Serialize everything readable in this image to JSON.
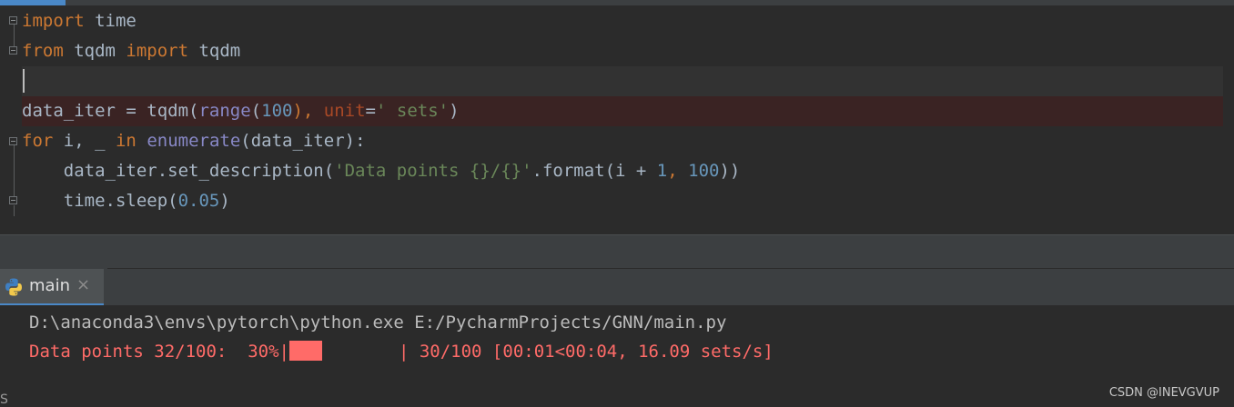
{
  "editor": {
    "lines": [
      {
        "kw1": "import",
        "t1": " time"
      },
      {
        "kw1": "from",
        "t1": " tqdm ",
        "kw2": "import",
        "t2": " tqdm"
      },
      {
        "text": ""
      },
      {
        "a": "data_iter = tqdm(",
        "b": "range",
        "c": "(",
        "d": "100",
        "e": "), ",
        "f": "unit",
        "g": "=",
        "h": "' sets'",
        "i": ")"
      },
      {
        "a": "for",
        "b": " i, _ ",
        "c": "in",
        "d": " ",
        "e": "enumerate",
        "f": "(data_iter):"
      },
      {
        "a": "    data_iter.set_description(",
        "b": "'Data points {}/{}'",
        "c": ".format(i + ",
        "d": "1",
        "e": ", ",
        "f": "100",
        "g": "))"
      },
      {
        "a": "    time.sleep(",
        "b": "0.05",
        "c": ")"
      }
    ]
  },
  "run_tab": {
    "label": "main",
    "close": "×"
  },
  "console": {
    "command": "D:\\anaconda3\\envs\\pytorch\\python.exe E:/PycharmProjects/GNN/main.py",
    "progress_prefix": "Data points 32/100:  30%|",
    "progress_fraction": 0.3,
    "progress_suffix": "| 30/100 [00:01<00:04, 16.09 sets/s]"
  },
  "watermark": "CSDN @INEVGVUP",
  "edge_glyph": "S",
  "colors": {
    "keyword": "#cc7832",
    "builtin": "#8888c6",
    "number": "#6897bb",
    "string": "#6a8759",
    "stderr": "#ff6b68",
    "accent": "#4a88c7"
  }
}
